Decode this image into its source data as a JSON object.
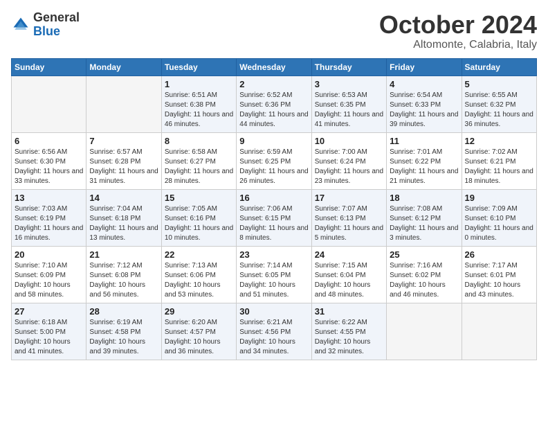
{
  "header": {
    "logo_general": "General",
    "logo_blue": "Blue",
    "title": "October 2024",
    "subtitle": "Altomonte, Calabria, Italy"
  },
  "weekdays": [
    "Sunday",
    "Monday",
    "Tuesday",
    "Wednesday",
    "Thursday",
    "Friday",
    "Saturday"
  ],
  "weeks": [
    [
      {
        "day": "",
        "sunrise": "",
        "sunset": "",
        "daylight": ""
      },
      {
        "day": "",
        "sunrise": "",
        "sunset": "",
        "daylight": ""
      },
      {
        "day": "1",
        "sunrise": "Sunrise: 6:51 AM",
        "sunset": "Sunset: 6:38 PM",
        "daylight": "Daylight: 11 hours and 46 minutes."
      },
      {
        "day": "2",
        "sunrise": "Sunrise: 6:52 AM",
        "sunset": "Sunset: 6:36 PM",
        "daylight": "Daylight: 11 hours and 44 minutes."
      },
      {
        "day": "3",
        "sunrise": "Sunrise: 6:53 AM",
        "sunset": "Sunset: 6:35 PM",
        "daylight": "Daylight: 11 hours and 41 minutes."
      },
      {
        "day": "4",
        "sunrise": "Sunrise: 6:54 AM",
        "sunset": "Sunset: 6:33 PM",
        "daylight": "Daylight: 11 hours and 39 minutes."
      },
      {
        "day": "5",
        "sunrise": "Sunrise: 6:55 AM",
        "sunset": "Sunset: 6:32 PM",
        "daylight": "Daylight: 11 hours and 36 minutes."
      }
    ],
    [
      {
        "day": "6",
        "sunrise": "Sunrise: 6:56 AM",
        "sunset": "Sunset: 6:30 PM",
        "daylight": "Daylight: 11 hours and 33 minutes."
      },
      {
        "day": "7",
        "sunrise": "Sunrise: 6:57 AM",
        "sunset": "Sunset: 6:28 PM",
        "daylight": "Daylight: 11 hours and 31 minutes."
      },
      {
        "day": "8",
        "sunrise": "Sunrise: 6:58 AM",
        "sunset": "Sunset: 6:27 PM",
        "daylight": "Daylight: 11 hours and 28 minutes."
      },
      {
        "day": "9",
        "sunrise": "Sunrise: 6:59 AM",
        "sunset": "Sunset: 6:25 PM",
        "daylight": "Daylight: 11 hours and 26 minutes."
      },
      {
        "day": "10",
        "sunrise": "Sunrise: 7:00 AM",
        "sunset": "Sunset: 6:24 PM",
        "daylight": "Daylight: 11 hours and 23 minutes."
      },
      {
        "day": "11",
        "sunrise": "Sunrise: 7:01 AM",
        "sunset": "Sunset: 6:22 PM",
        "daylight": "Daylight: 11 hours and 21 minutes."
      },
      {
        "day": "12",
        "sunrise": "Sunrise: 7:02 AM",
        "sunset": "Sunset: 6:21 PM",
        "daylight": "Daylight: 11 hours and 18 minutes."
      }
    ],
    [
      {
        "day": "13",
        "sunrise": "Sunrise: 7:03 AM",
        "sunset": "Sunset: 6:19 PM",
        "daylight": "Daylight: 11 hours and 16 minutes."
      },
      {
        "day": "14",
        "sunrise": "Sunrise: 7:04 AM",
        "sunset": "Sunset: 6:18 PM",
        "daylight": "Daylight: 11 hours and 13 minutes."
      },
      {
        "day": "15",
        "sunrise": "Sunrise: 7:05 AM",
        "sunset": "Sunset: 6:16 PM",
        "daylight": "Daylight: 11 hours and 10 minutes."
      },
      {
        "day": "16",
        "sunrise": "Sunrise: 7:06 AM",
        "sunset": "Sunset: 6:15 PM",
        "daylight": "Daylight: 11 hours and 8 minutes."
      },
      {
        "day": "17",
        "sunrise": "Sunrise: 7:07 AM",
        "sunset": "Sunset: 6:13 PM",
        "daylight": "Daylight: 11 hours and 5 minutes."
      },
      {
        "day": "18",
        "sunrise": "Sunrise: 7:08 AM",
        "sunset": "Sunset: 6:12 PM",
        "daylight": "Daylight: 11 hours and 3 minutes."
      },
      {
        "day": "19",
        "sunrise": "Sunrise: 7:09 AM",
        "sunset": "Sunset: 6:10 PM",
        "daylight": "Daylight: 11 hours and 0 minutes."
      }
    ],
    [
      {
        "day": "20",
        "sunrise": "Sunrise: 7:10 AM",
        "sunset": "Sunset: 6:09 PM",
        "daylight": "Daylight: 10 hours and 58 minutes."
      },
      {
        "day": "21",
        "sunrise": "Sunrise: 7:12 AM",
        "sunset": "Sunset: 6:08 PM",
        "daylight": "Daylight: 10 hours and 56 minutes."
      },
      {
        "day": "22",
        "sunrise": "Sunrise: 7:13 AM",
        "sunset": "Sunset: 6:06 PM",
        "daylight": "Daylight: 10 hours and 53 minutes."
      },
      {
        "day": "23",
        "sunrise": "Sunrise: 7:14 AM",
        "sunset": "Sunset: 6:05 PM",
        "daylight": "Daylight: 10 hours and 51 minutes."
      },
      {
        "day": "24",
        "sunrise": "Sunrise: 7:15 AM",
        "sunset": "Sunset: 6:04 PM",
        "daylight": "Daylight: 10 hours and 48 minutes."
      },
      {
        "day": "25",
        "sunrise": "Sunrise: 7:16 AM",
        "sunset": "Sunset: 6:02 PM",
        "daylight": "Daylight: 10 hours and 46 minutes."
      },
      {
        "day": "26",
        "sunrise": "Sunrise: 7:17 AM",
        "sunset": "Sunset: 6:01 PM",
        "daylight": "Daylight: 10 hours and 43 minutes."
      }
    ],
    [
      {
        "day": "27",
        "sunrise": "Sunrise: 6:18 AM",
        "sunset": "Sunset: 5:00 PM",
        "daylight": "Daylight: 10 hours and 41 minutes."
      },
      {
        "day": "28",
        "sunrise": "Sunrise: 6:19 AM",
        "sunset": "Sunset: 4:58 PM",
        "daylight": "Daylight: 10 hours and 39 minutes."
      },
      {
        "day": "29",
        "sunrise": "Sunrise: 6:20 AM",
        "sunset": "Sunset: 4:57 PM",
        "daylight": "Daylight: 10 hours and 36 minutes."
      },
      {
        "day": "30",
        "sunrise": "Sunrise: 6:21 AM",
        "sunset": "Sunset: 4:56 PM",
        "daylight": "Daylight: 10 hours and 34 minutes."
      },
      {
        "day": "31",
        "sunrise": "Sunrise: 6:22 AM",
        "sunset": "Sunset: 4:55 PM",
        "daylight": "Daylight: 10 hours and 32 minutes."
      },
      {
        "day": "",
        "sunrise": "",
        "sunset": "",
        "daylight": ""
      },
      {
        "day": "",
        "sunrise": "",
        "sunset": "",
        "daylight": ""
      }
    ]
  ]
}
